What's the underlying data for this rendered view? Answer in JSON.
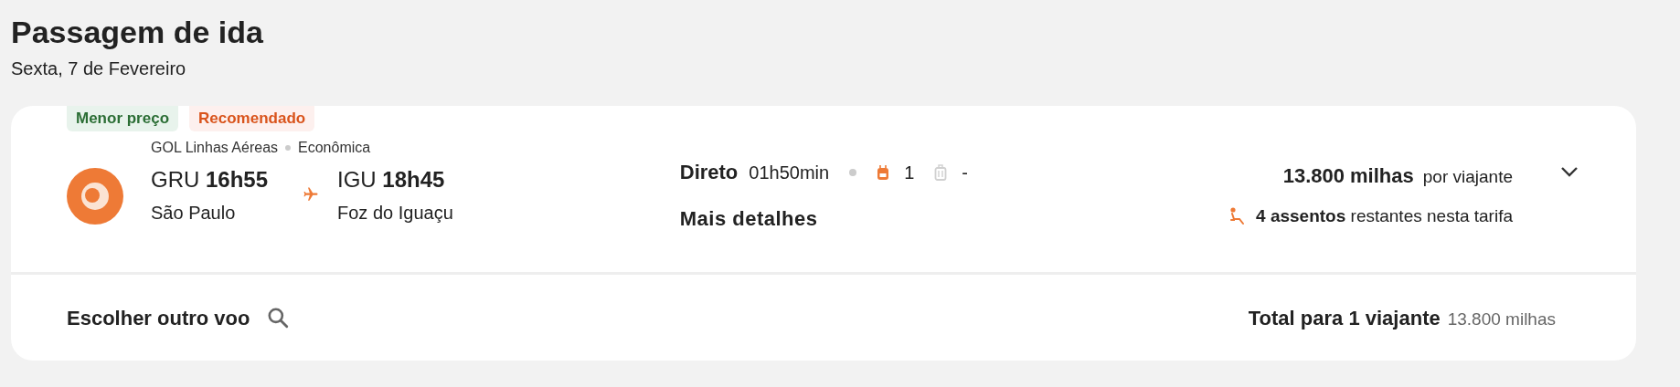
{
  "page": {
    "title": "Passagem de ida",
    "date": "Sexta, 7 de Fevereiro"
  },
  "flight": {
    "badges": [
      {
        "label": "Menor preço",
        "kind": "cheapest"
      },
      {
        "label": "Recomendado",
        "kind": "recommended"
      }
    ],
    "airline": "GOL Linhas Aéreas",
    "cabin": "Econômica",
    "origin": {
      "code": "GRU",
      "time": "16h55",
      "city": "São Paulo"
    },
    "destination": {
      "code": "IGU",
      "time": "18h45",
      "city": "Foz do Iguaçu"
    },
    "stops": "Direto",
    "duration": "01h50min",
    "baggage": [
      {
        "kind": "backpack",
        "included": true,
        "count": "1"
      },
      {
        "kind": "suitcase",
        "included": false,
        "count": "-"
      }
    ],
    "details_link": "Mais detalhes",
    "price": "13.800 milhas",
    "price_unit": "por viajante",
    "seats": "4 assentos",
    "seats_note": "restantes nesta tarifa",
    "expanded": false
  },
  "footer": {
    "choose_other": "Escolher outro voo",
    "total_label": "Total para 1 viajante",
    "total_value": "13.800 milhas"
  }
}
